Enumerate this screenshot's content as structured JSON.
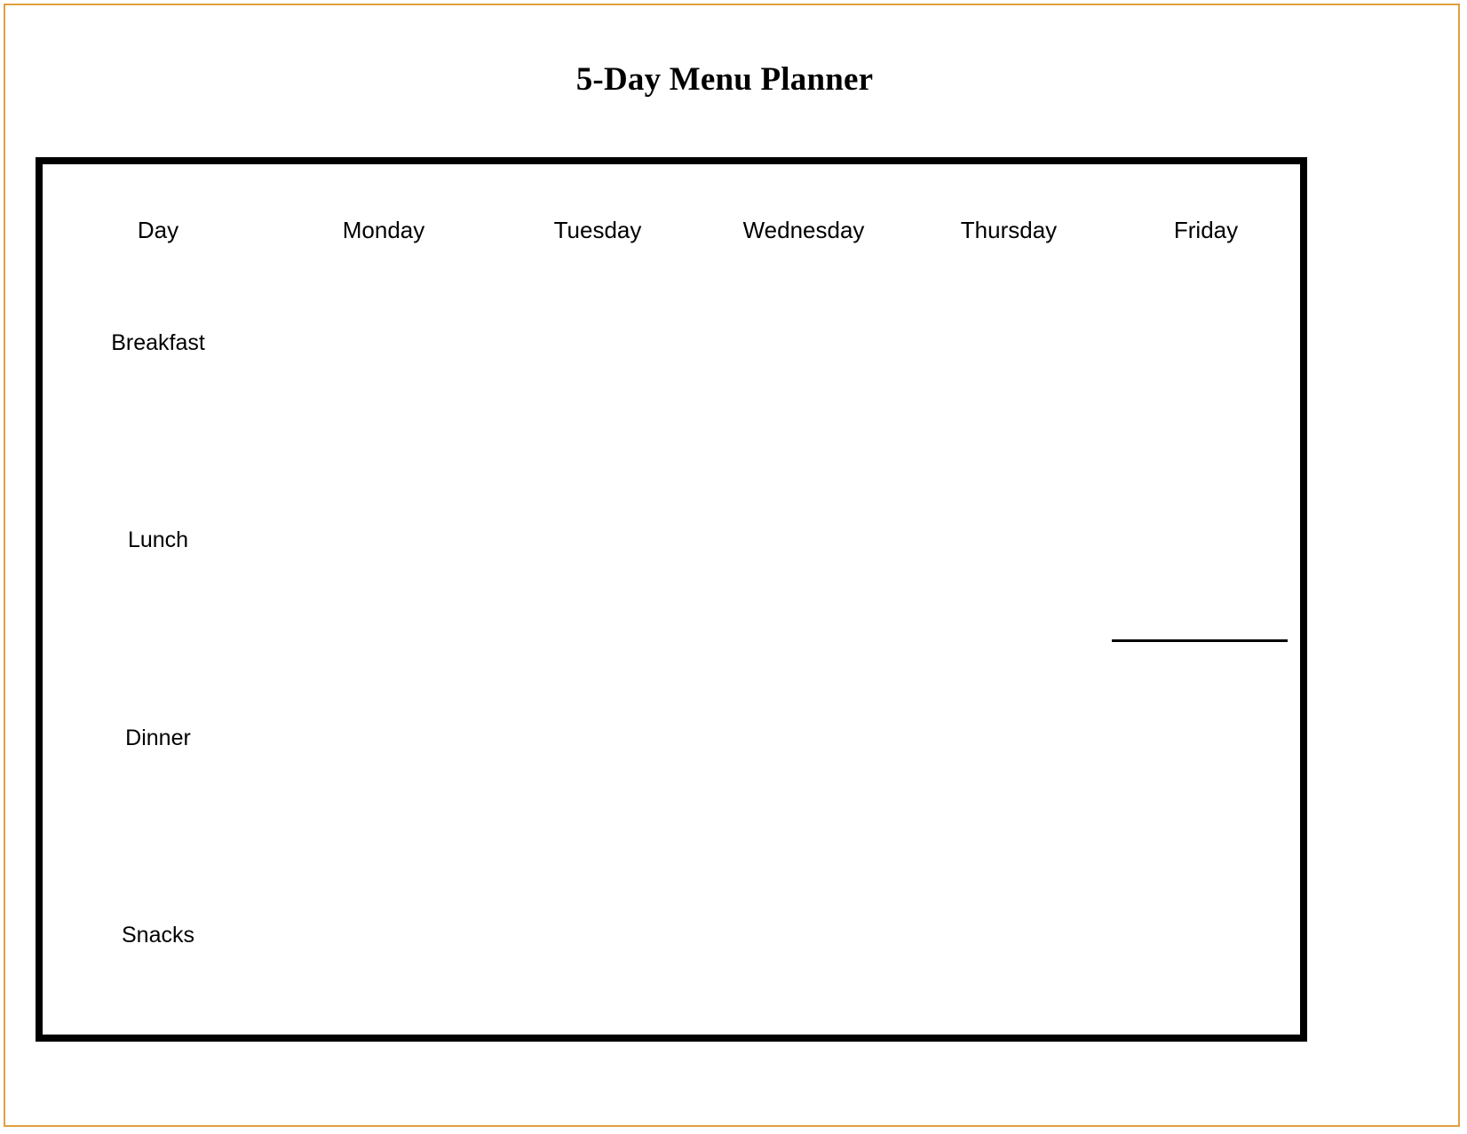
{
  "page": {
    "title": "5-Day Menu Planner",
    "border_color": "#e0a040",
    "table_border_color": "#000000",
    "background": "#ffffff"
  },
  "planner": {
    "columns": [
      {
        "key": "day",
        "label": "Day"
      },
      {
        "key": "monday",
        "label": "Monday"
      },
      {
        "key": "tuesday",
        "label": "Tuesday"
      },
      {
        "key": "wednesday",
        "label": "Wednesday"
      },
      {
        "key": "thursday",
        "label": "Thursday"
      },
      {
        "key": "friday",
        "label": "Friday"
      }
    ],
    "rows": [
      {
        "key": "breakfast",
        "label": "Breakfast",
        "monday": "",
        "tuesday": "",
        "wednesday": "",
        "thursday": "",
        "friday": ""
      },
      {
        "key": "lunch",
        "label": "Lunch",
        "monday": "",
        "tuesday": "",
        "wednesday": "",
        "thursday": "",
        "friday": ""
      },
      {
        "key": "dinner",
        "label": "Dinner",
        "monday": "",
        "tuesday": "",
        "wednesday": "",
        "thursday": "",
        "friday": ""
      },
      {
        "key": "snacks",
        "label": "Snacks",
        "monday": "",
        "tuesday": "",
        "wednesday": "",
        "thursday": "",
        "friday": ""
      }
    ]
  }
}
